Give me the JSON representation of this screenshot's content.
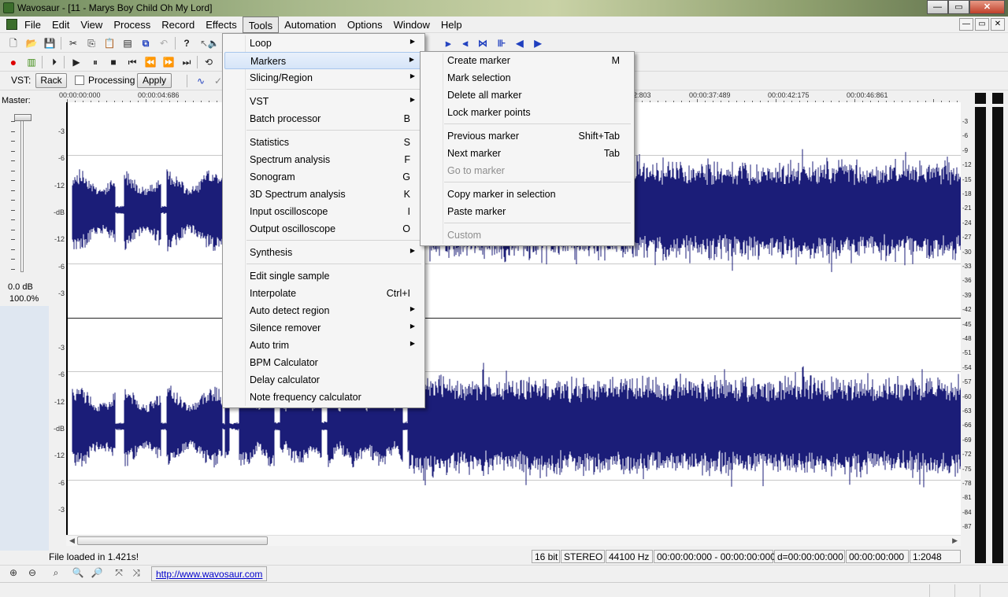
{
  "window": {
    "title": "Wavosaur - [11 - Marys Boy Child  Oh My Lord]",
    "minimize": "—",
    "maximize": "▭",
    "close": "✕"
  },
  "menubar": {
    "items": [
      "File",
      "Edit",
      "View",
      "Process",
      "Record",
      "Effects",
      "Tools",
      "Automation",
      "Options",
      "Window",
      "Help"
    ],
    "active": "Tools",
    "mdi_buttons": [
      "—",
      "▭",
      "✕"
    ]
  },
  "toolbar": {
    "vst_label": "VST:",
    "rack_label": "Rack",
    "processing_label": "Processing",
    "apply_label": "Apply"
  },
  "master": {
    "label": "Master:",
    "db": "0.0 dB",
    "percent": "100.0%"
  },
  "timeline": {
    "labels": [
      "00:00:00:000",
      "00:00:04:686",
      "2:803",
      "00:00:37:489",
      "00:00:42:175",
      "00:00:46:861"
    ]
  },
  "amp_scale": {
    "top_channel": [
      "-3",
      "-6",
      "-12",
      "-dB",
      "-12",
      "-6",
      "-3"
    ],
    "bottom_channel": [
      "-3",
      "-6",
      "-12",
      "-dB",
      "-12",
      "-6",
      "-3"
    ]
  },
  "meter_scale": [
    "-3",
    "-6",
    "-9",
    "-12",
    "-15",
    "-18",
    "-21",
    "-24",
    "-27",
    "-30",
    "-33",
    "-36",
    "-39",
    "-42",
    "-45",
    "-48",
    "-51",
    "-54",
    "-57",
    "-60",
    "-63",
    "-66",
    "-69",
    "-72",
    "-75",
    "-78",
    "-81",
    "-84",
    "-87"
  ],
  "status": {
    "message": "File loaded in 1.421s!",
    "bits": "16 bit",
    "channels": "STEREO",
    "rate": "44100 Hz",
    "range": "00:00:00:000 - 00:00:00:000",
    "duration": "d=00:00:00:000",
    "position": "00:00:00:000",
    "zoom": "1:2048"
  },
  "link": "http://www.wavosaur.com",
  "tools_menu": {
    "items": [
      {
        "label": "Loop",
        "shortcut": "",
        "submenu": true
      },
      {
        "label": "Markers",
        "shortcut": "",
        "submenu": true,
        "highlighted": true
      },
      {
        "label": "Slicing/Region",
        "shortcut": "",
        "submenu": true
      },
      {
        "separator": true
      },
      {
        "label": "VST",
        "shortcut": "",
        "submenu": true
      },
      {
        "label": "Batch processor",
        "shortcut": "B"
      },
      {
        "separator": true
      },
      {
        "label": "Statistics",
        "shortcut": "S"
      },
      {
        "label": "Spectrum analysis",
        "shortcut": "F"
      },
      {
        "label": "Sonogram",
        "shortcut": "G"
      },
      {
        "label": "3D Spectrum analysis",
        "shortcut": "K"
      },
      {
        "label": "Input oscilloscope",
        "shortcut": "I"
      },
      {
        "label": "Output oscilloscope",
        "shortcut": "O"
      },
      {
        "separator": true
      },
      {
        "label": "Synthesis",
        "shortcut": "",
        "submenu": true
      },
      {
        "separator": true
      },
      {
        "label": "Edit single sample",
        "shortcut": ""
      },
      {
        "label": "Interpolate",
        "shortcut": "Ctrl+I"
      },
      {
        "label": "Auto detect region",
        "shortcut": "",
        "submenu": true
      },
      {
        "label": "Silence remover",
        "shortcut": "",
        "submenu": true
      },
      {
        "label": "Auto trim",
        "shortcut": "",
        "submenu": true
      },
      {
        "label": "BPM Calculator",
        "shortcut": ""
      },
      {
        "label": "Delay calculator",
        "shortcut": ""
      },
      {
        "label": "Note frequency calculator",
        "shortcut": ""
      }
    ]
  },
  "markers_menu": {
    "items": [
      {
        "label": "Create marker",
        "shortcut": "M"
      },
      {
        "label": "Mark selection",
        "shortcut": ""
      },
      {
        "label": "Delete all marker",
        "shortcut": ""
      },
      {
        "label": "Lock marker points",
        "shortcut": ""
      },
      {
        "separator": true
      },
      {
        "label": "Previous marker",
        "shortcut": "Shift+Tab"
      },
      {
        "label": "Next marker",
        "shortcut": "Tab"
      },
      {
        "label": "Go to marker",
        "shortcut": "",
        "disabled": true
      },
      {
        "separator": true
      },
      {
        "label": "Copy marker in selection",
        "shortcut": ""
      },
      {
        "label": "Paste marker",
        "shortcut": ""
      },
      {
        "separator": true
      },
      {
        "label": "Custom",
        "shortcut": "",
        "disabled": true
      }
    ]
  },
  "colors": {
    "waveform": "#1b1d78",
    "menu_highlight": "#d6e5f8"
  }
}
